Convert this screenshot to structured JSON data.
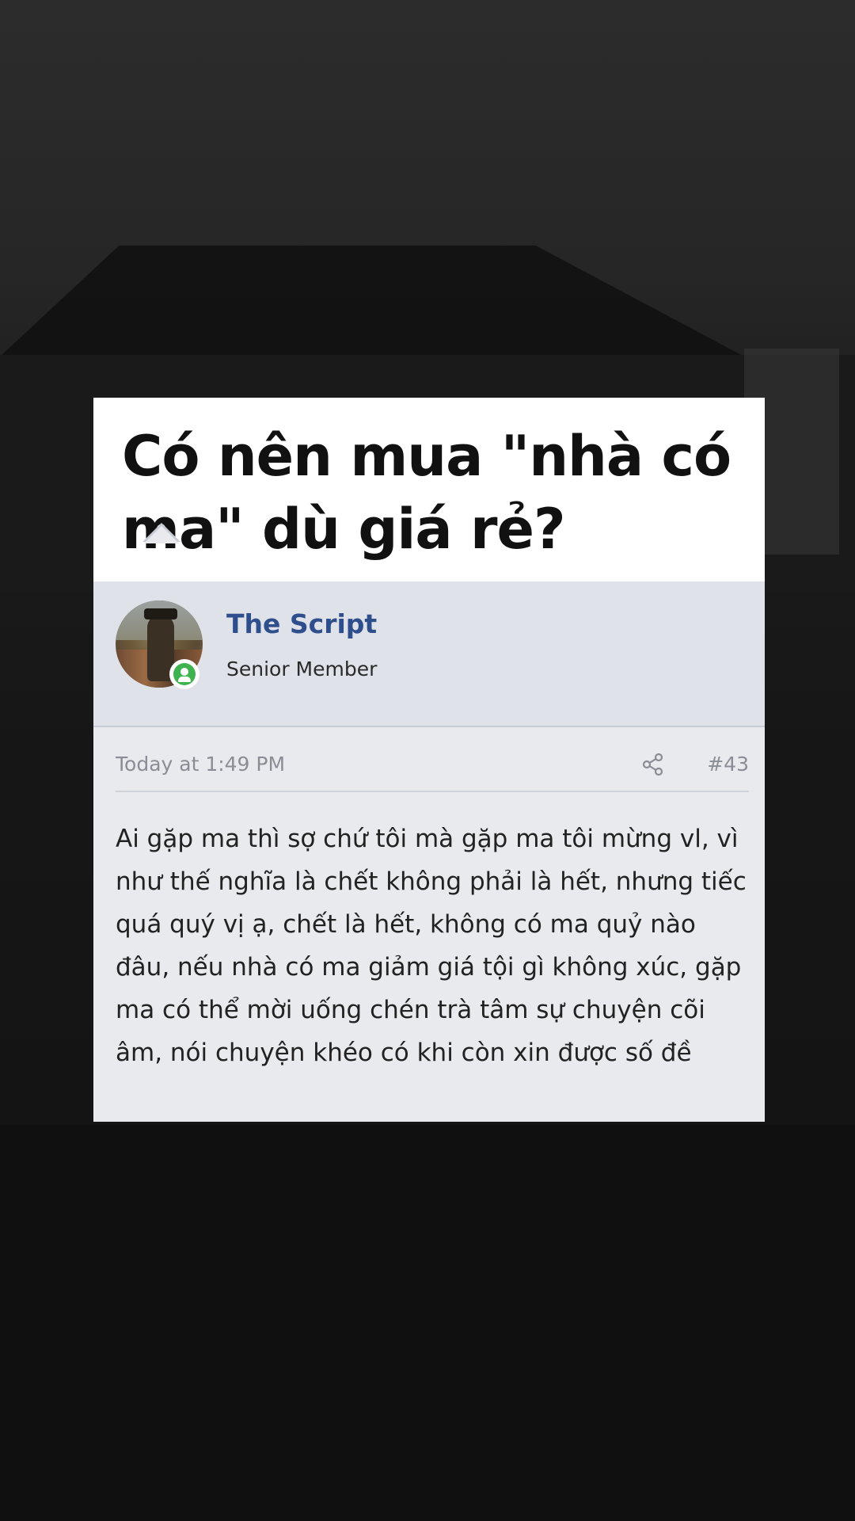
{
  "post": {
    "title": "Có nên mua \"nhà có ma\" dù giá rẻ?",
    "author": {
      "name": "The Script",
      "role": "Senior Member",
      "online_icon": "user-online-icon"
    },
    "timestamp": "Today at 1:49 PM",
    "post_number": "#43",
    "share_icon": "share-icon",
    "body": "Ai gặp ma thì sợ chứ tôi mà gặp ma tôi mừng vl, vì như thế nghĩa là chết không phải là hết, nhưng tiếc quá quý vị ạ, chết là hết, không có ma quỷ nào đâu, nếu nhà có ma giảm giá tội gì không xúc, gặp ma có thể mời uống chén trà tâm sự chuyện cõi âm, nói chuyện khéo có khi còn xin được số đề"
  },
  "colors": {
    "username": "#2e4e8c",
    "online": "#3fb34f",
    "card_bg": "#e9eaee",
    "author_bg": "#dfe2e9"
  }
}
